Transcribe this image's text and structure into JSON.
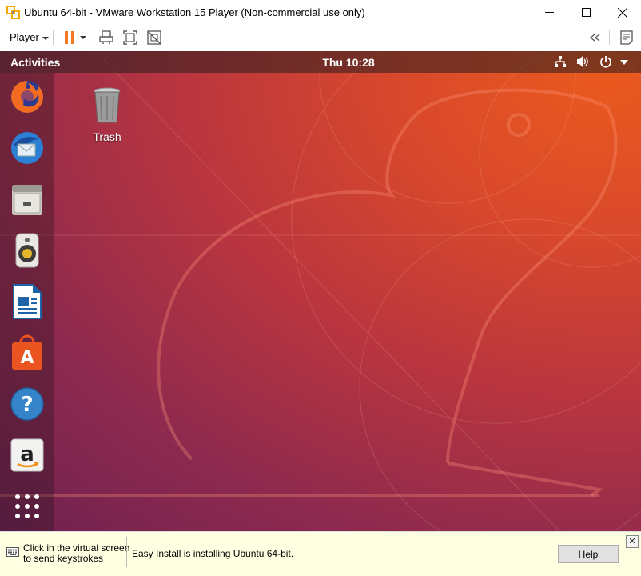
{
  "window": {
    "title": "Ubuntu 64-bit - VMware Workstation 15 Player (Non-commercial use only)",
    "controls": [
      "minimize-icon",
      "maximize-icon",
      "close-icon"
    ]
  },
  "toolbar": {
    "player_label": "Player",
    "icons": [
      "pause-icon",
      "send-ctrl-alt-del-icon",
      "fullscreen-icon",
      "unity-icon",
      "collapse-icon",
      "message-log-icon"
    ]
  },
  "guest": {
    "topbar": {
      "activities": "Activities",
      "clock": "Thu 10:28",
      "status_icons": [
        "network-icon",
        "volume-icon",
        "power-icon"
      ]
    },
    "dock": [
      "firefox-icon",
      "thunderbird-icon",
      "files-icon",
      "rhythmbox-icon",
      "libreoffice-writer-icon",
      "ubuntu-software-icon",
      "help-icon",
      "amazon-icon",
      "show-applications-icon"
    ],
    "desktop": {
      "trash_label": "Trash"
    }
  },
  "statusbar": {
    "hint_line1": "Click in the virtual screen",
    "hint_line2": "to send keystrokes",
    "message": "Easy Install is installing Ubuntu 64-bit.",
    "help_label": "Help"
  },
  "colors": {
    "ubuntu_orange": "#e95420",
    "aubergine": "#77216f",
    "pause_orange": "#f47920"
  }
}
